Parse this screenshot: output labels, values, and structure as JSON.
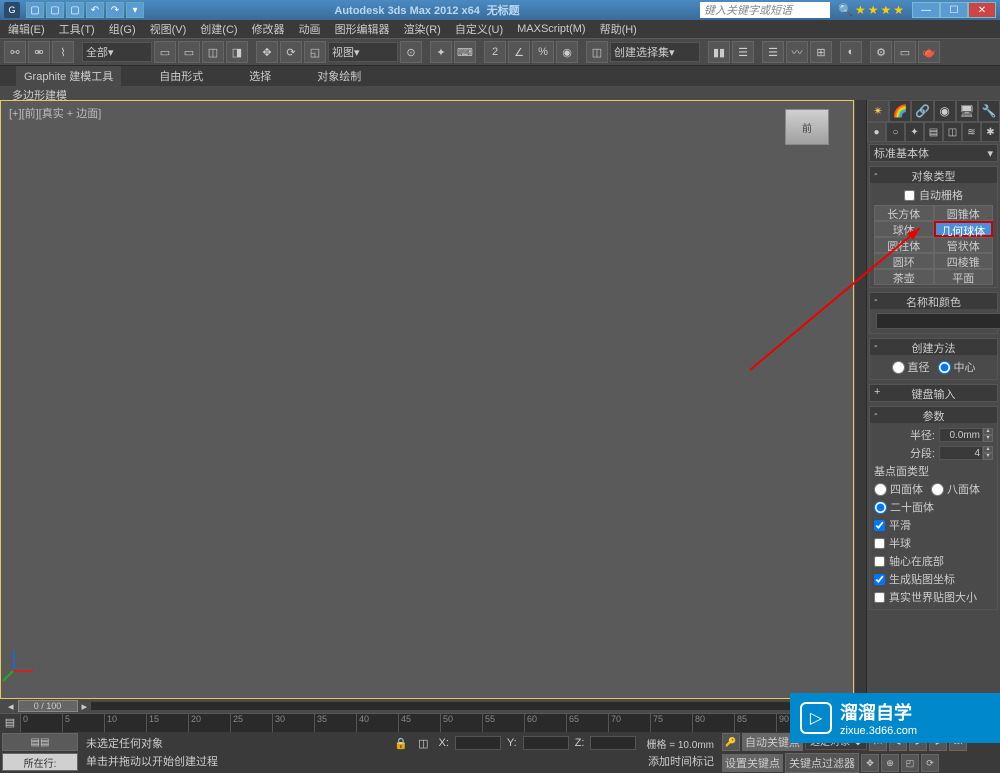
{
  "titlebar": {
    "app_title": "Autodesk 3ds Max 2012 x64",
    "doc_title": "无标题",
    "search_placeholder": "键入关键字或短语"
  },
  "menubar": {
    "items": [
      "编辑(E)",
      "工具(T)",
      "组(G)",
      "视图(V)",
      "创建(C)",
      "修改器",
      "动画",
      "图形编辑器",
      "渲染(R)",
      "自定义(U)",
      "MAXScript(M)",
      "帮助(H)"
    ]
  },
  "toolbar": {
    "scope_label": "全部",
    "view_label": "视图",
    "selset_label": "创建选择集"
  },
  "ribbon": {
    "tabs": [
      "Graphite 建模工具",
      "自由形式",
      "选择",
      "对象绘制"
    ],
    "sub_label": "多边形建模"
  },
  "viewport": {
    "label": "[+][前][真实 + 边面]",
    "viewcube": "前"
  },
  "cmdpanel": {
    "category_dropdown": "标准基本体",
    "rollouts": {
      "object_type": {
        "title": "对象类型",
        "autogrid": "自动栅格",
        "buttons": [
          "长方体",
          "圆锥体",
          "球体",
          "几何球体",
          "圆柱体",
          "管状体",
          "圆环",
          "四棱锥",
          "茶壶",
          "平面"
        ]
      },
      "name_color": {
        "title": "名称和颜色"
      },
      "creation_method": {
        "title": "创建方法",
        "opt_diameter": "直径",
        "opt_center": "中心"
      },
      "keyboard_entry": {
        "title": "键盘输入"
      },
      "parameters": {
        "title": "参数",
        "radius_label": "半径:",
        "radius_value": "0.0mm",
        "segs_label": "分段:",
        "segs_value": "4",
        "base_type_label": "基点面类型",
        "opt_tetra": "四面体",
        "opt_octa": "八面体",
        "opt_icosa": "二十面体",
        "chk_smooth": "平滑",
        "chk_hemi": "半球",
        "chk_base_pivot": "轴心在底部",
        "chk_mapping": "生成贴图坐标",
        "chk_realworld": "真实世界贴图大小"
      }
    }
  },
  "timeline": {
    "frame_display": "0 / 100",
    "ticks": [
      "0",
      "5",
      "10",
      "15",
      "20",
      "25",
      "30",
      "35",
      "40",
      "45",
      "50",
      "55",
      "60",
      "65",
      "70",
      "75",
      "80",
      "85",
      "90"
    ]
  },
  "status": {
    "row_btn": "所在行:",
    "msg1": "未选定任何对象",
    "msg2": "单击并拖动以开始创建过程",
    "add_time_tag": "添加时间标记",
    "x_label": "X:",
    "y_label": "Y:",
    "z_label": "Z:",
    "grid_label": "栅格 = 10.0mm",
    "autokey": "自动关键点",
    "setkey": "设置关键点",
    "selset": "选定对象",
    "keyfilter": "关键点过滤器"
  },
  "watermark": {
    "name": "溜溜自学",
    "url": "zixue.3d66.com"
  }
}
